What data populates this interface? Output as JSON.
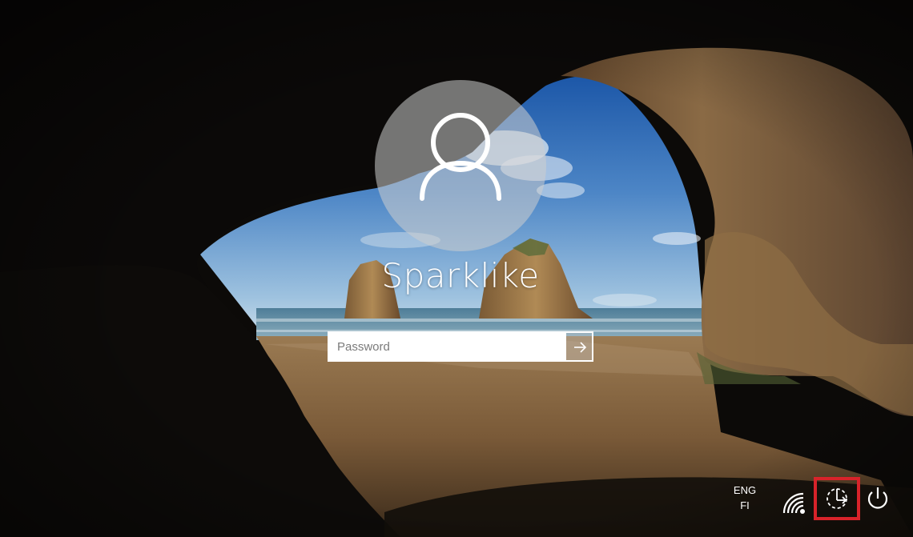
{
  "lock_screen": {
    "username": "Sparklike",
    "password": {
      "placeholder": "Password",
      "value": "",
      "submit_icon": "arrow-right-icon"
    },
    "avatar_icon": "user-icon"
  },
  "tray": {
    "language": {
      "line1": "ENG",
      "line2": "FI"
    },
    "icons": [
      "wifi-icon",
      "ease-of-access-icon",
      "power-icon"
    ],
    "highlight_color": "#d8232a"
  }
}
